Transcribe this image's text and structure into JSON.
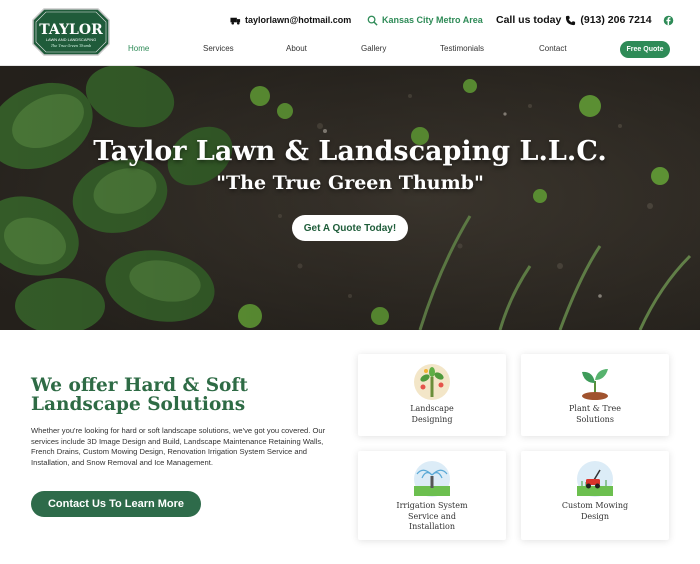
{
  "brand": {
    "logo_name": "TAYLOR",
    "logo_tagline": "LAWN AND LANDSCAPING",
    "logo_motto": "The True Green Thumb"
  },
  "topbar": {
    "email": "taylorlawn@hotmail.com",
    "area": "Kansas City Metro Area",
    "call_label": "Call us today",
    "phone": "(913) 206 7214",
    "social_icon": "facebook-icon"
  },
  "nav": {
    "items": [
      "Home",
      "Services",
      "About",
      "Gallery",
      "Testimonials",
      "Contact"
    ],
    "active": "Home",
    "quote_button": "Free Quote"
  },
  "hero": {
    "title": "Taylor Lawn & Landscaping L.L.C.",
    "subtitle": "\"The True Green Thumb\"",
    "button": "Get A Quote Today!"
  },
  "intro": {
    "title": "We offer Hard & Soft Landscape Solutions",
    "body": "Whether you're looking for hard or soft landscape solutions, we've got you covered. Our services include 3D Image Design and Build, Landscape Maintenance Retaining Walls, French Drains, Custom Mowing Design, Renovation Irrigation System Service and Installation, and Snow Removal and Ice Management.",
    "cta": "Contact Us To Learn More"
  },
  "services": [
    {
      "label": "Landscape Designing",
      "icon": "plant-bush-icon"
    },
    {
      "label": "Plant & Tree Solutions",
      "icon": "sprout-icon"
    },
    {
      "label": "Irrigation System Service and Installation",
      "icon": "sprinkler-icon"
    },
    {
      "label": "Custom Mowing Design",
      "icon": "lawn-mower-icon"
    }
  ],
  "colors": {
    "brand_green": "#2e8b57",
    "dark_green": "#2e6b45"
  }
}
